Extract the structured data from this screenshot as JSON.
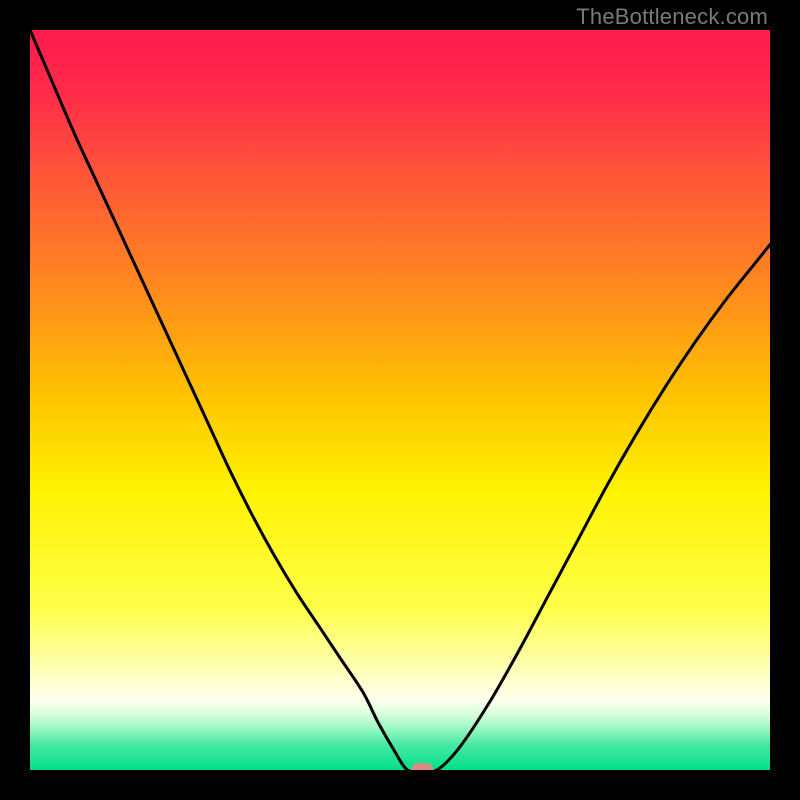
{
  "attribution": "TheBottleneck.com",
  "colors": {
    "frame": "#000000",
    "attribution_text": "#7a7a7a",
    "curve": "#000000",
    "marker": "#d98d81",
    "gradient_stops": [
      {
        "offset": 0.0,
        "color": "#ff1a4e"
      },
      {
        "offset": 0.08,
        "color": "#ff2a4a"
      },
      {
        "offset": 0.2,
        "color": "#ff5638"
      },
      {
        "offset": 0.35,
        "color": "#ff8a1e"
      },
      {
        "offset": 0.5,
        "color": "#ffc500"
      },
      {
        "offset": 0.62,
        "color": "#fff200"
      },
      {
        "offset": 0.78,
        "color": "#ffff4a"
      },
      {
        "offset": 0.86,
        "color": "#ffffb0"
      },
      {
        "offset": 0.905,
        "color": "#fffff0"
      },
      {
        "offset": 0.925,
        "color": "#d8ffdc"
      },
      {
        "offset": 0.945,
        "color": "#95f7c0"
      },
      {
        "offset": 0.965,
        "color": "#4be9a4"
      },
      {
        "offset": 1.0,
        "color": "#00e08a"
      }
    ]
  },
  "chart_data": {
    "type": "line",
    "title": "",
    "xlabel": "",
    "ylabel": "",
    "x_range": [
      0,
      100
    ],
    "y_range": [
      0,
      100
    ],
    "grid": false,
    "legend": false,
    "series": [
      {
        "name": "bottleneck-curve",
        "x": [
          0,
          3,
          6,
          9,
          12,
          15,
          18,
          21,
          24,
          27,
          30,
          33,
          36,
          39,
          42,
          45,
          47,
          49,
          51,
          53,
          55,
          58,
          62,
          66,
          70,
          74,
          78,
          82,
          86,
          90,
          94,
          98,
          100
        ],
        "y": [
          100,
          93,
          86,
          79.5,
          73,
          66.5,
          60,
          53.5,
          47,
          40.5,
          34.5,
          29,
          24,
          19.5,
          15,
          10.5,
          6.5,
          3,
          0,
          0,
          0,
          3,
          9,
          16,
          23.5,
          31,
          38.5,
          45.5,
          52,
          58,
          63.5,
          68.5,
          71
        ]
      }
    ],
    "marker": {
      "x": 53,
      "y": 0
    },
    "notes": "V-shaped bottleneck curve plotted over a vertical red→orange→yellow→pale→green gradient. The minimum (0%) lies at roughly x≈53; left branch starts near 100% at x=0, right branch rises to ≈71% at x=100. Values are estimates read from the image since the chart has no axes or tick labels."
  }
}
